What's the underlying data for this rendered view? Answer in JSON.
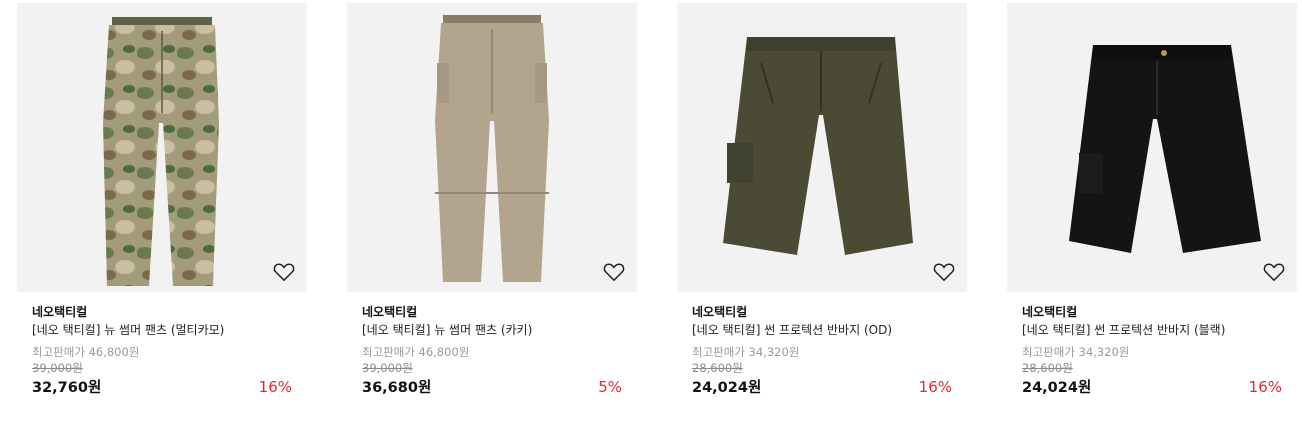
{
  "products": [
    {
      "brand": "네오택티컬",
      "name": "[네오 택티컬] 뉴 썸머 팬츠 (멀티카모)",
      "max_label": "최고판매가 46,800원",
      "original_price": "39,000원",
      "price": "32,760원",
      "discount": "16%",
      "image_icon": "camo-pants-image",
      "color": "#8d8a68"
    },
    {
      "brand": "네오택티컬",
      "name": "[네오 택티컬] 뉴 썸머 팬츠 (카키)",
      "max_label": "최고판매가 46,800원",
      "original_price": "39,000원",
      "price": "36,680원",
      "discount": "5%",
      "image_icon": "khaki-pants-image",
      "color": "#b2a48d"
    },
    {
      "brand": "네오택티컬",
      "name": "[네오 택티컬] 썬 프로텍션 반바지 (OD)",
      "max_label": "최고판매가 34,320원",
      "original_price": "28,600원",
      "price": "24,024원",
      "discount": "16%",
      "image_icon": "od-shorts-image",
      "color": "#4a4a35"
    },
    {
      "brand": "네오택티컬",
      "name": "[네오 택티컬] 썬 프로텍션 반바지 (블랙)",
      "max_label": "최고판매가 34,320원",
      "original_price": "28,600원",
      "price": "24,024원",
      "discount": "16%",
      "image_icon": "black-shorts-image",
      "color": "#141414"
    }
  ],
  "theme": {
    "discount_color": "#e8282b",
    "thumb_bg": "#f2f2f2"
  }
}
